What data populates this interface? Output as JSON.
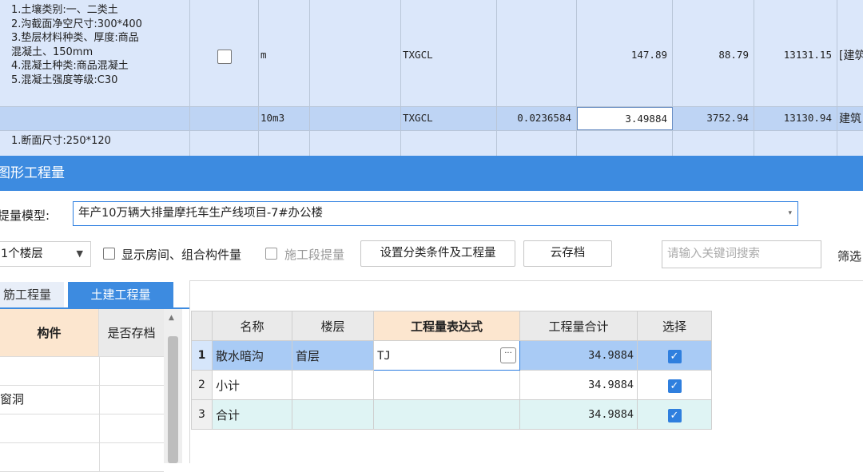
{
  "background_sheet": {
    "row1": {
      "description": "1.土壤类别:一、二类土\n2.沟截面净空尺寸:300*400\n3.垫层材料种类、厚度:商品\n混凝土、150mm\n4.混凝土种类:商品混凝土\n5.混凝土强度等级:C30",
      "unit": "m",
      "code": "TXGCL",
      "qty": "147.89",
      "price": "88.79",
      "amount": "13131.15",
      "category": "[建筑"
    },
    "row2": {
      "unit": "10m3",
      "code": "TXGCL",
      "factor": "0.0236584",
      "qty": "3.49884",
      "price": "3752.94",
      "amount": "13130.94",
      "category": "建筑"
    },
    "row3": {
      "description": "1.断面尺寸:250*120"
    }
  },
  "dialog": {
    "title": "图形工程量",
    "model_label": "提量模型:",
    "model_value": "年产10万辆大排量摩托车生产线项目-7#办公楼",
    "floor_value": "1个楼层",
    "show_rooms_label": "显示房间、组合构件量",
    "stage_label": "施工段提量",
    "set_conditions_button": "设置分类条件及工程量",
    "cloud_save_button": "云存档",
    "search_placeholder": "请输入关键词搜索",
    "filter_label": "筛选",
    "tabs": [
      "筋工程量",
      "土建工程量"
    ],
    "left_table": {
      "headers": [
        "构件",
        "是否存档"
      ],
      "rows": [
        "",
        "窗洞",
        "",
        "",
        ""
      ]
    },
    "qty_table": {
      "headers": [
        "名称",
        "楼层",
        "工程量表达式",
        "工程量合计",
        "选择"
      ],
      "rows": [
        {
          "idx": "1",
          "name": "散水暗沟",
          "floor": "首层",
          "expr": "TJ",
          "total": "34.9884",
          "checked": true
        },
        {
          "idx": "2",
          "name": "小计",
          "floor": "",
          "expr": "",
          "total": "34.9884",
          "checked": true
        },
        {
          "idx": "3",
          "name": "合计",
          "floor": "",
          "expr": "",
          "total": "34.9884",
          "checked": true
        }
      ]
    }
  }
}
